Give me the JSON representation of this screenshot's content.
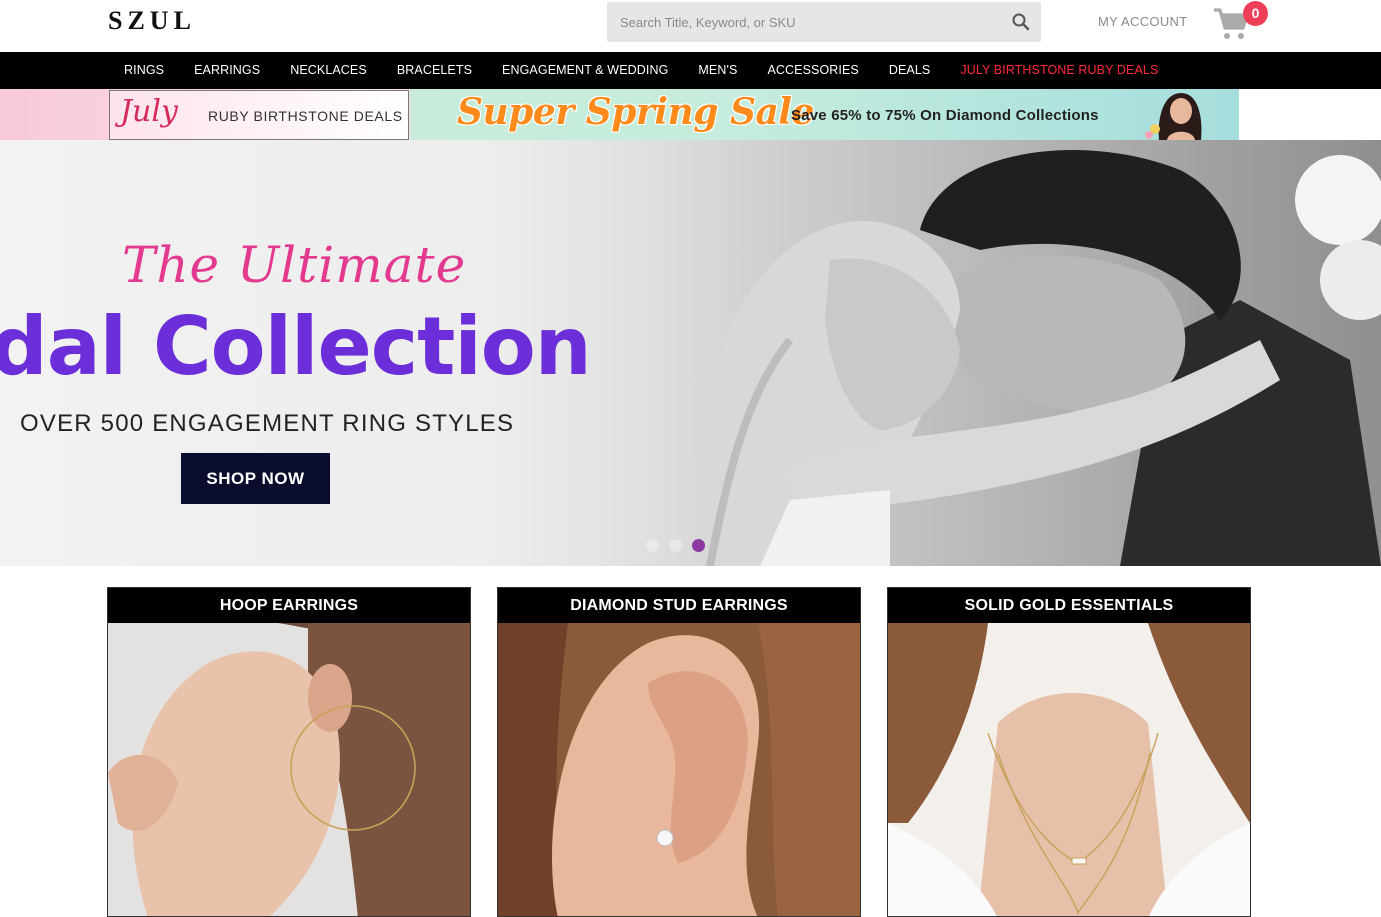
{
  "header": {
    "logo": "SZUL",
    "search_placeholder": "Search Title, Keyword, or SKU",
    "account_label": "MY ACCOUNT",
    "cart_count": "0"
  },
  "nav": {
    "items": [
      "RINGS",
      "EARRINGS",
      "NECKLACES",
      "BRACELETS",
      "ENGAGEMENT & WEDDING",
      "MEN'S",
      "ACCESSORIES",
      "DEALS",
      "JULY BIRTHSTONE RUBY DEALS"
    ],
    "highlight_color": "#ff2a3a"
  },
  "promo": {
    "left_script": "July",
    "left_text": "RUBY BIRTHSTONE DEALS",
    "right_title": "Super Spring Sale",
    "right_text": "Save 65% to 75% On Diamond Collections"
  },
  "hero": {
    "script": "The Ultimate",
    "title": "idal Collection",
    "subtitle": "OVER 500 ENGAGEMENT RING STYLES",
    "button": "SHOP NOW",
    "slides": 3,
    "active_slide": 3,
    "title_color": "#6b2ed9",
    "script_color": "#e33a8f"
  },
  "categories": [
    {
      "label": "HOOP EARRINGS"
    },
    {
      "label": "DIAMOND STUD EARRINGS"
    },
    {
      "label": "SOLID GOLD ESSENTIALS"
    }
  ]
}
